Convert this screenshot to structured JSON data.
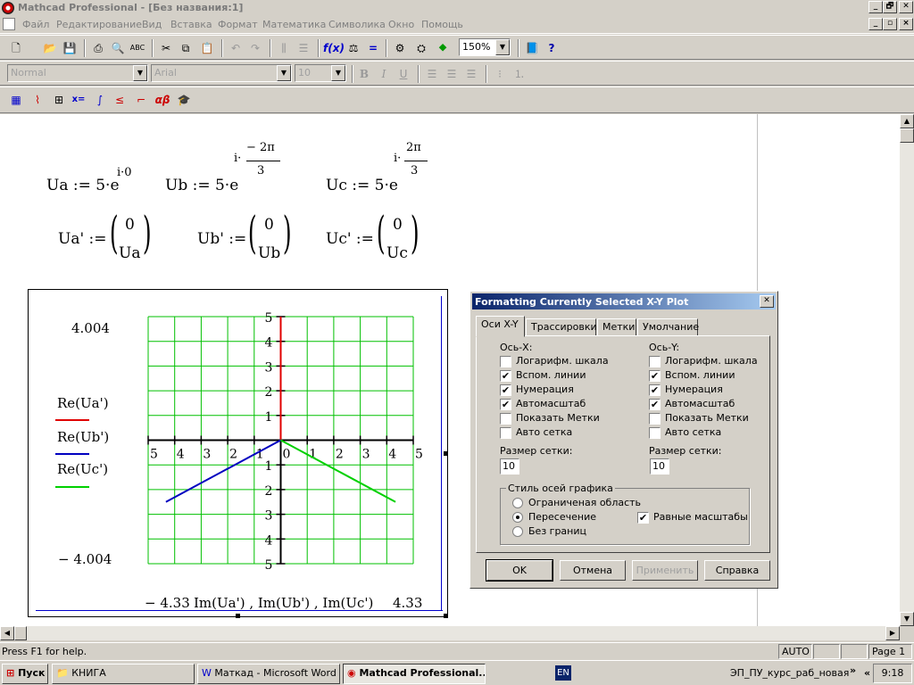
{
  "window": {
    "title": "Mathcad Professional - [Без названия:1]",
    "minimize": "_",
    "maximize": "🗗",
    "close": "✕"
  },
  "menu": [
    "Файл",
    "Редактирование",
    "Вид",
    "Вставка",
    "Формат",
    "Математика",
    "Символика",
    "Окно",
    "Помощь"
  ],
  "toolbar": {
    "zoom": "150%"
  },
  "format_bar": {
    "style": "Normal",
    "font": "Arial",
    "size": "10",
    "bold": "B",
    "italic": "I",
    "underline": "U"
  },
  "math_bar": {
    "eval": "x=",
    "greek": "αβ"
  },
  "worksheet": {
    "ua_lhs": "Ua := 5·e",
    "ua_exp": "i·0",
    "ub_lhs": "Ub := 5·e",
    "ub_exp_i": "i·",
    "ub_exp_num": "− 2π",
    "ub_exp_den": "3",
    "uc_lhs": "Uc := 5·e",
    "uc_exp_i": "i·",
    "uc_exp_num": "2π",
    "uc_exp_den": "3",
    "ua_vec_lhs": "Ua' :=",
    "ua_vec_top": "0",
    "ua_vec_bot": "Ua",
    "ub_vec_lhs": "Ub' :=",
    "ub_vec_top": "0",
    "ub_vec_bot": "Ub",
    "uc_vec_lhs": "Uc' :=",
    "uc_vec_top": "0",
    "uc_vec_bot": "Uc"
  },
  "plot": {
    "y_max_label": "4.004",
    "y_min_label": "− 4.004",
    "x_min_label": "− 4.33",
    "x_max_label": "4.33",
    "x_expr": "Im(Ua') , Im(Ub') , Im(Uc')",
    "legend": [
      {
        "label": "Re(Ua')",
        "color": "#e00000"
      },
      {
        "label": "Re(Ub')",
        "color": "#0000c0"
      },
      {
        "label": "Re(Uc')",
        "color": "#00d000"
      }
    ]
  },
  "chart_data": {
    "type": "line",
    "xlim": [
      -5,
      5
    ],
    "ylim": [
      -5,
      5
    ],
    "grid": true,
    "x_ticks": [
      "5",
      "4",
      "3",
      "2",
      "1",
      "0",
      "1",
      "2",
      "3",
      "4",
      "5"
    ],
    "y_ticks": [
      "5",
      "4",
      "3",
      "2",
      "1",
      "0",
      "1",
      "2",
      "3",
      "4",
      "5"
    ],
    "series": [
      {
        "name": "Re(Ua')",
        "color": "#e00000",
        "x": [
          0,
          0
        ],
        "y": [
          0,
          5
        ]
      },
      {
        "name": "Re(Ub')",
        "color": "#0000c0",
        "x": [
          0,
          -4.33
        ],
        "y": [
          0,
          -2.5
        ]
      },
      {
        "name": "Re(Uc')",
        "color": "#00d000",
        "x": [
          0,
          4.33
        ],
        "y": [
          0,
          -2.5
        ]
      }
    ]
  },
  "dialog": {
    "title": "Formatting Currently Selected X-Y Plot",
    "close": "✕",
    "tabs": [
      "Оси X-Y",
      "Трассировки",
      "Метки",
      "Умолчание"
    ],
    "x_axis_label": "Ось-X:",
    "y_axis_label": "Ось-Y:",
    "options": [
      {
        "label": "Логарифм. шкала",
        "x": false,
        "y": false
      },
      {
        "label": "Вспом. линии",
        "x": true,
        "y": true
      },
      {
        "label": "Нумерация",
        "x": true,
        "y": true
      },
      {
        "label": "Автомасштаб",
        "x": true,
        "y": true
      },
      {
        "label": "Показать Метки",
        "x": false,
        "y": false
      },
      {
        "label": "Авто сетка",
        "x": false,
        "y": false
      }
    ],
    "grid_size_label": "Размер сетки:",
    "x_grid_size": "10",
    "y_grid_size": "10",
    "axes_style_title": "Стиль осей графика",
    "axes_style_options": [
      "Ограниченая область",
      "Пересечение",
      "Без границ"
    ],
    "axes_style_selected": "Пересечение",
    "equal_scales_label": "Равные масштабы",
    "equal_scales_checked": true,
    "ok": "OK",
    "cancel": "Отмена",
    "apply": "Применить",
    "help": "Справка"
  },
  "status": {
    "help": "Press F1 for help.",
    "mode": "AUTO",
    "page": "Page 1"
  },
  "taskbar": {
    "start": "Пуск",
    "tasks": [
      "КНИГА",
      "Маткад - Microsoft Word",
      "Mathcad Professional..."
    ],
    "lang": "EN",
    "tray_text": "ЭП_ПУ_курс_раб_новая",
    "chevron": "»",
    "back": "«",
    "time": "9:18"
  },
  "check_mark": "✔"
}
